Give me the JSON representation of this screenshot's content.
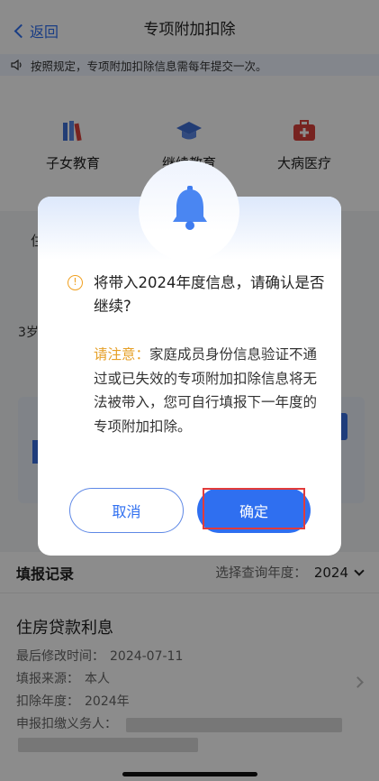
{
  "header": {
    "back_label": "返回",
    "title": "专项附加扣除"
  },
  "notice": "按照规定，专项附加扣除信息需每年提交一次。",
  "categories": [
    {
      "label": "子女教育",
      "icon": "books-icon"
    },
    {
      "label": "继续教育",
      "icon": "graduation-cap-icon"
    },
    {
      "label": "大病医疗",
      "icon": "medical-kit-icon"
    }
  ],
  "background_peek": {
    "left_char": "住",
    "left_text": "3岁"
  },
  "records": {
    "title": "填报记录",
    "filter_label": "选择查询年度：",
    "year": "2024",
    "item": {
      "title": "住房贷款利息",
      "rows": [
        {
          "label": "最后修改时间：",
          "value": "2024-07-11"
        },
        {
          "label": "填报来源：",
          "value": "本人"
        },
        {
          "label": "扣除年度：",
          "value": "2024年"
        },
        {
          "label": "申报扣缴义务人：",
          "value": ""
        }
      ]
    }
  },
  "dialog": {
    "icon": "bell-icon",
    "message": "将带入2024年度信息，请确认是否继续?",
    "note_label": "请注意：",
    "note_text": "家庭成员身份信息验证不通过或已失效的专项附加扣除信息将无法被带入，您可自行填报下一年度的专项附加扣除。",
    "cancel_label": "取消",
    "confirm_label": "确定"
  },
  "colors": {
    "accent": "#2f6ff0",
    "warning": "#f0a020",
    "highlight": "#e23b3b"
  }
}
